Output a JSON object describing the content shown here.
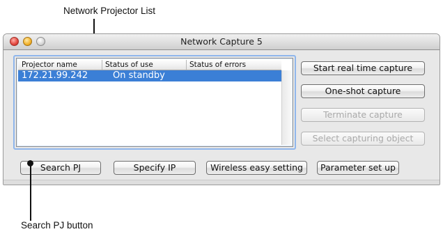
{
  "annotations": {
    "top_label": "Network Projector List",
    "bottom_label": "Search PJ button"
  },
  "window": {
    "title": "Network Capture 5"
  },
  "list": {
    "columns": [
      "Projector name",
      "Status of use",
      "Status of errors"
    ],
    "rows": [
      {
        "projector_name": "172.21.99.242",
        "status_of_use": "On standby",
        "status_of_errors": ""
      }
    ]
  },
  "right_buttons": {
    "start": "Start real time capture",
    "oneshot": "One-shot capture",
    "terminate": "Terminate capture",
    "select_object": "Select capturing object"
  },
  "bottom_buttons": {
    "search": "Search PJ",
    "specify_ip": "Specify IP",
    "wireless": "Wireless easy setting",
    "parameter": "Parameter set up"
  }
}
